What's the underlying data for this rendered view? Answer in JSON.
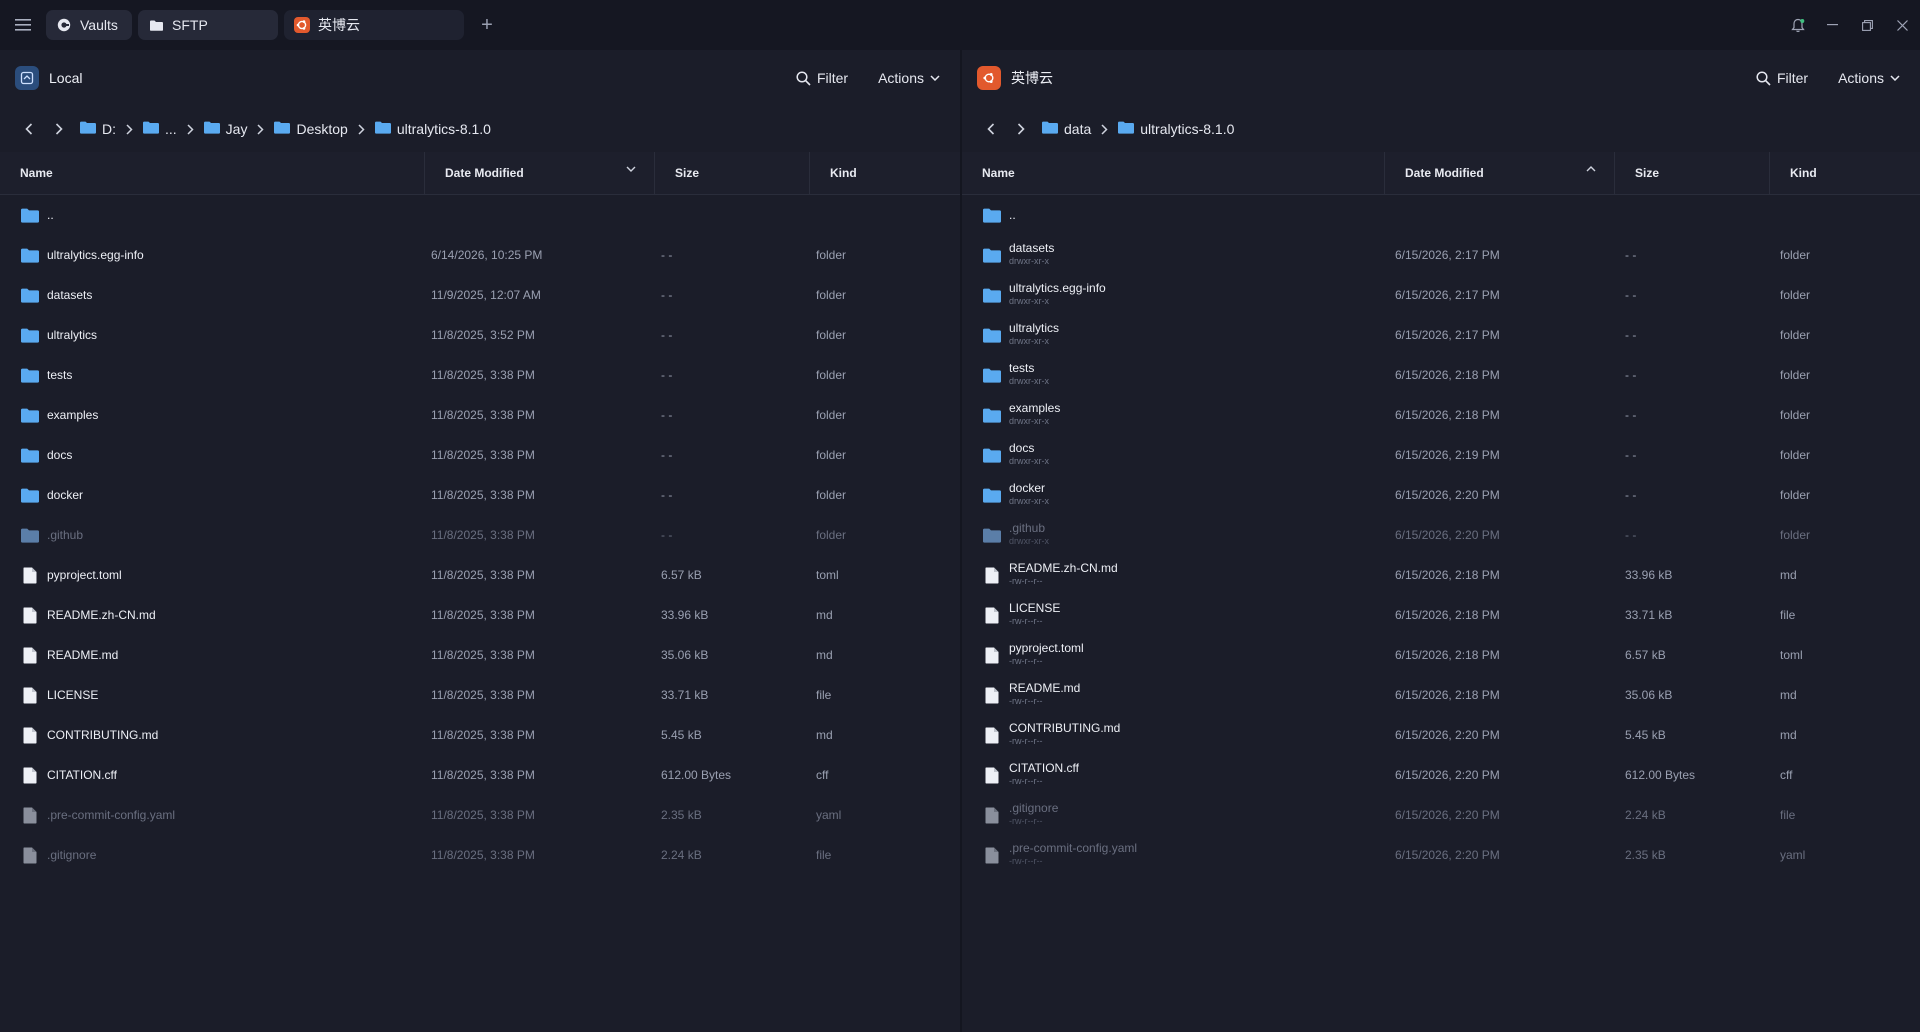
{
  "tabs": [
    {
      "label": "Vaults",
      "icon": "vault-icon"
    },
    {
      "label": "SFTP",
      "icon": "folder-icon"
    },
    {
      "label": "英博云",
      "icon": "ubuntu-icon"
    }
  ],
  "colors": {
    "accent_folder": "#5aaaf0",
    "remote_badge": "#e2592d",
    "local_badge": "#2b4d7c",
    "background": "#1b1d29"
  },
  "local": {
    "title": "Local",
    "filter_label": "Filter",
    "actions_label": "Actions",
    "breadcrumb": [
      "D:",
      "...",
      "Jay",
      "Desktop",
      "ultralytics-8.1.0"
    ],
    "columns": {
      "name": "Name",
      "date": "Date Modified",
      "size": "Size",
      "kind": "Kind"
    },
    "rows": [
      {
        "name": "..",
        "date": "",
        "size": "",
        "kind": "",
        "type": "folder",
        "hidden": false
      },
      {
        "name": "ultralytics.egg-info",
        "date": "6/14/2026, 10:25 PM",
        "size": "- -",
        "kind": "folder",
        "type": "folder",
        "hidden": false
      },
      {
        "name": "datasets",
        "date": "11/9/2025, 12:07 AM",
        "size": "- -",
        "kind": "folder",
        "type": "folder",
        "hidden": false
      },
      {
        "name": "ultralytics",
        "date": "11/8/2025, 3:52 PM",
        "size": "- -",
        "kind": "folder",
        "type": "folder",
        "hidden": false
      },
      {
        "name": "tests",
        "date": "11/8/2025, 3:38 PM",
        "size": "- -",
        "kind": "folder",
        "type": "folder",
        "hidden": false
      },
      {
        "name": "examples",
        "date": "11/8/2025, 3:38 PM",
        "size": "- -",
        "kind": "folder",
        "type": "folder",
        "hidden": false
      },
      {
        "name": "docs",
        "date": "11/8/2025, 3:38 PM",
        "size": "- -",
        "kind": "folder",
        "type": "folder",
        "hidden": false
      },
      {
        "name": "docker",
        "date": "11/8/2025, 3:38 PM",
        "size": "- -",
        "kind": "folder",
        "type": "folder",
        "hidden": false
      },
      {
        "name": ".github",
        "date": "11/8/2025, 3:38 PM",
        "size": "- -",
        "kind": "folder",
        "type": "folder",
        "hidden": true
      },
      {
        "name": "pyproject.toml",
        "date": "11/8/2025, 3:38 PM",
        "size": "6.57 kB",
        "kind": "toml",
        "type": "file",
        "hidden": false
      },
      {
        "name": "README.zh-CN.md",
        "date": "11/8/2025, 3:38 PM",
        "size": "33.96 kB",
        "kind": "md",
        "type": "file",
        "hidden": false
      },
      {
        "name": "README.md",
        "date": "11/8/2025, 3:38 PM",
        "size": "35.06 kB",
        "kind": "md",
        "type": "file",
        "hidden": false
      },
      {
        "name": "LICENSE",
        "date": "11/8/2025, 3:38 PM",
        "size": "33.71 kB",
        "kind": "file",
        "type": "file",
        "hidden": false
      },
      {
        "name": "CONTRIBUTING.md",
        "date": "11/8/2025, 3:38 PM",
        "size": "5.45 kB",
        "kind": "md",
        "type": "file",
        "hidden": false
      },
      {
        "name": "CITATION.cff",
        "date": "11/8/2025, 3:38 PM",
        "size": "612.00 Bytes",
        "kind": "cff",
        "type": "file",
        "hidden": false
      },
      {
        "name": ".pre-commit-config.yaml",
        "date": "11/8/2025, 3:38 PM",
        "size": "2.35 kB",
        "kind": "yaml",
        "type": "file",
        "hidden": true
      },
      {
        "name": ".gitignore",
        "date": "11/8/2025, 3:38 PM",
        "size": "2.24 kB",
        "kind": "file",
        "type": "file",
        "hidden": true
      }
    ]
  },
  "remote": {
    "title": "英博云",
    "filter_label": "Filter",
    "actions_label": "Actions",
    "breadcrumb": [
      "data",
      "ultralytics-8.1.0"
    ],
    "columns": {
      "name": "Name",
      "date": "Date Modified",
      "size": "Size",
      "kind": "Kind"
    },
    "rows": [
      {
        "name": "..",
        "perm": "",
        "date": "",
        "size": "",
        "kind": "",
        "type": "folder",
        "hidden": false
      },
      {
        "name": "datasets",
        "perm": "drwxr-xr-x",
        "date": "6/15/2026, 2:17 PM",
        "size": "- -",
        "kind": "folder",
        "type": "folder",
        "hidden": false
      },
      {
        "name": "ultralytics.egg-info",
        "perm": "drwxr-xr-x",
        "date": "6/15/2026, 2:17 PM",
        "size": "- -",
        "kind": "folder",
        "type": "folder",
        "hidden": false
      },
      {
        "name": "ultralytics",
        "perm": "drwxr-xr-x",
        "date": "6/15/2026, 2:17 PM",
        "size": "- -",
        "kind": "folder",
        "type": "folder",
        "hidden": false
      },
      {
        "name": "tests",
        "perm": "drwxr-xr-x",
        "date": "6/15/2026, 2:18 PM",
        "size": "- -",
        "kind": "folder",
        "type": "folder",
        "hidden": false
      },
      {
        "name": "examples",
        "perm": "drwxr-xr-x",
        "date": "6/15/2026, 2:18 PM",
        "size": "- -",
        "kind": "folder",
        "type": "folder",
        "hidden": false
      },
      {
        "name": "docs",
        "perm": "drwxr-xr-x",
        "date": "6/15/2026, 2:19 PM",
        "size": "- -",
        "kind": "folder",
        "type": "folder",
        "hidden": false
      },
      {
        "name": "docker",
        "perm": "drwxr-xr-x",
        "date": "6/15/2026, 2:20 PM",
        "size": "- -",
        "kind": "folder",
        "type": "folder",
        "hidden": false
      },
      {
        "name": ".github",
        "perm": "drwxr-xr-x",
        "date": "6/15/2026, 2:20 PM",
        "size": "- -",
        "kind": "folder",
        "type": "folder",
        "hidden": true
      },
      {
        "name": "README.zh-CN.md",
        "perm": "-rw-r--r--",
        "date": "6/15/2026, 2:18 PM",
        "size": "33.96 kB",
        "kind": "md",
        "type": "file",
        "hidden": false
      },
      {
        "name": "LICENSE",
        "perm": "-rw-r--r--",
        "date": "6/15/2026, 2:18 PM",
        "size": "33.71 kB",
        "kind": "file",
        "type": "file",
        "hidden": false
      },
      {
        "name": "pyproject.toml",
        "perm": "-rw-r--r--",
        "date": "6/15/2026, 2:18 PM",
        "size": "6.57 kB",
        "kind": "toml",
        "type": "file",
        "hidden": false
      },
      {
        "name": "README.md",
        "perm": "-rw-r--r--",
        "date": "6/15/2026, 2:18 PM",
        "size": "35.06 kB",
        "kind": "md",
        "type": "file",
        "hidden": false
      },
      {
        "name": "CONTRIBUTING.md",
        "perm": "-rw-r--r--",
        "date": "6/15/2026, 2:20 PM",
        "size": "5.45 kB",
        "kind": "md",
        "type": "file",
        "hidden": false
      },
      {
        "name": "CITATION.cff",
        "perm": "-rw-r--r--",
        "date": "6/15/2026, 2:20 PM",
        "size": "612.00 Bytes",
        "kind": "cff",
        "type": "file",
        "hidden": false
      },
      {
        "name": ".gitignore",
        "perm": "-rw-r--r--",
        "date": "6/15/2026, 2:20 PM",
        "size": "2.24 kB",
        "kind": "file",
        "type": "file",
        "hidden": true
      },
      {
        "name": ".pre-commit-config.yaml",
        "perm": "-rw-r--r--",
        "date": "6/15/2026, 2:20 PM",
        "size": "2.35 kB",
        "kind": "yaml",
        "type": "file",
        "hidden": true
      }
    ]
  }
}
